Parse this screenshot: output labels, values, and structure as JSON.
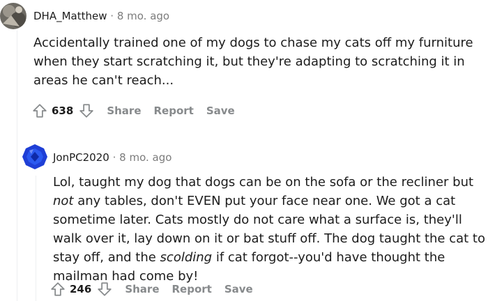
{
  "comments": [
    {
      "author": "DHA_Matthew",
      "separator": "·",
      "time": "8 mo. ago",
      "body": "Accidentally trained one of my dogs to chase my cats off my furniture when they start scratching it, but they're adapting to scratching it in areas he can't reach...",
      "score": "638",
      "share_label": "Share",
      "report_label": "Report",
      "save_label": "Save"
    },
    {
      "author": "JonPC2020",
      "separator": "·",
      "time": "8 mo. ago",
      "body_parts": [
        "Lol, taught my dog that dogs can be on the sofa or the recliner but ",
        "not",
        " any tables, don't EVEN put your face near one. We got a cat sometime later. Cats mostly do not care what a surface is, they'll walk over it, lay down on it or bat stuff off. The dog taught the cat to stay off, and the ",
        "scolding",
        " if cat forgot--you'd have thought the mailman had come by!"
      ],
      "score": "246",
      "share_label": "Share",
      "report_label": "Report",
      "save_label": "Save"
    }
  ],
  "colors": {
    "meta_gray": "#7c7c7c",
    "action_gray": "#878a8c",
    "text": "#1c1c1c",
    "thread_line": "#edeff1",
    "avatar_blue": "#1f3fd6"
  },
  "icons": {
    "upvote": "arrow-up-outline-icon",
    "downvote": "arrow-down-outline-icon"
  }
}
